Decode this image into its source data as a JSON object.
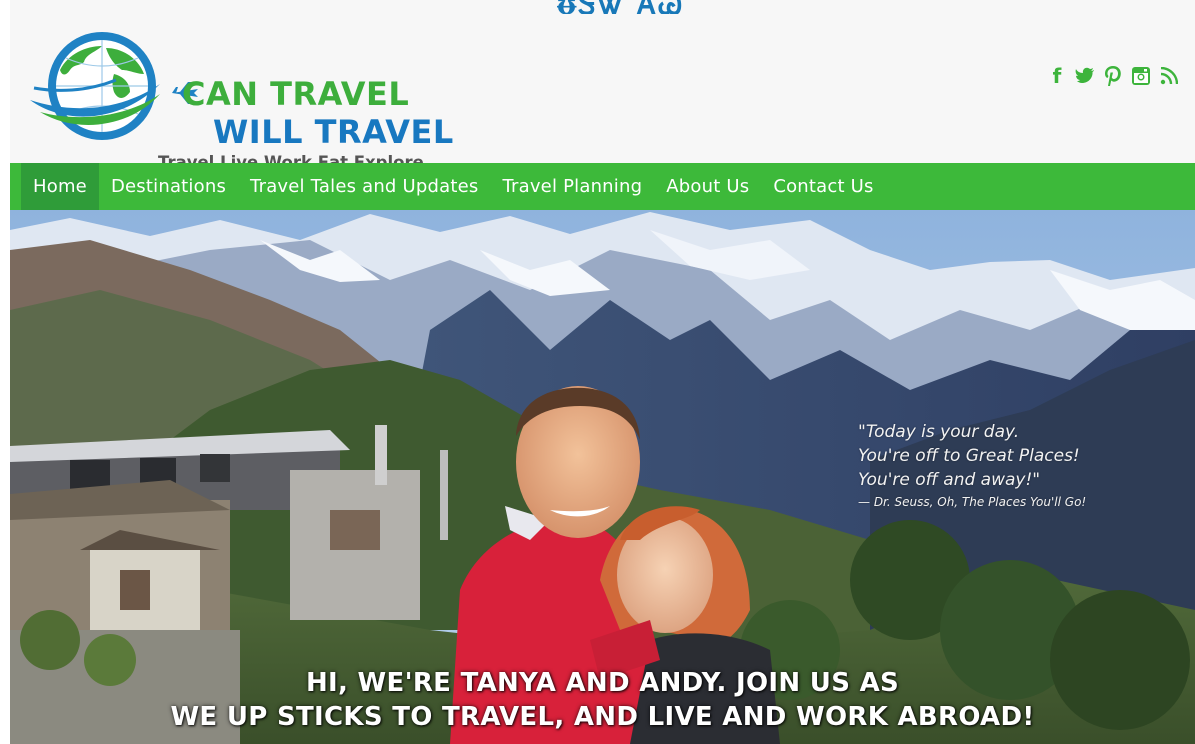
{
  "site": {
    "top_deco": "ᵿᏕᏔ ᎪᏊ",
    "logo": {
      "line1": "CAN TRAVEL",
      "line2": "WILL TRAVEL",
      "tagline": "Travel Live Work Eat Explore"
    },
    "social": [
      {
        "icon": "facebook-icon",
        "glyph": "f"
      },
      {
        "icon": "twitter-icon",
        "glyph": "t"
      },
      {
        "icon": "pinterest-icon",
        "glyph": "p"
      },
      {
        "icon": "instagram-icon",
        "glyph": "i"
      },
      {
        "icon": "rss-icon",
        "glyph": "r"
      }
    ]
  },
  "nav": {
    "items": [
      {
        "label": "Home",
        "active": true
      },
      {
        "label": "Destinations"
      },
      {
        "label": "Travel Tales and Updates"
      },
      {
        "label": "Travel Planning"
      },
      {
        "label": "About Us"
      },
      {
        "label": "Contact Us"
      }
    ]
  },
  "hero": {
    "quote_lines": [
      "\"Today is your day.",
      "You're off to Great Places!",
      "You're off and away!\""
    ],
    "quote_attribution": "— Dr. Seuss, Oh, The Places You'll Go!",
    "headline_lines": [
      "HI, WE'RE TANYA AND ANDY. JOIN US AS",
      "WE UP STICKS TO TRAVEL, AND LIVE AND WORK ABROAD!"
    ]
  },
  "colors": {
    "brand_green": "#3db93a",
    "brand_blue": "#1878c0",
    "nav_active": "#2f9c39"
  }
}
